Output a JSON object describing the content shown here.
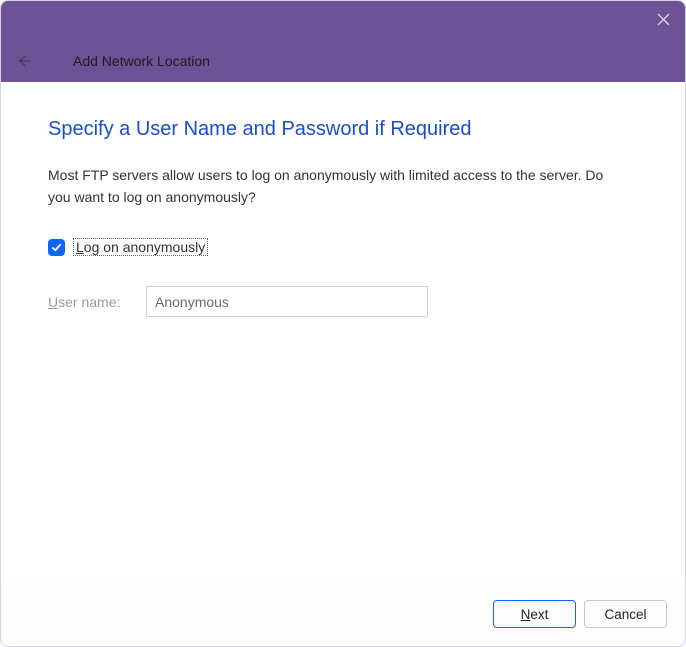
{
  "window": {
    "wizard_name": "Add Network Location",
    "heading": "Specify a User Name and Password if Required",
    "description": "Most FTP servers allow users to log on anonymously with limited access to the server.  Do you want to log on anonymously?"
  },
  "checkbox": {
    "checked": true,
    "prefix": "L",
    "rest": "og on anonymously"
  },
  "username": {
    "label_prefix": "U",
    "label_rest": "ser name:",
    "value": "Anonymous"
  },
  "buttons": {
    "next_prefix": "N",
    "next_rest": "ext",
    "cancel": "Cancel"
  }
}
